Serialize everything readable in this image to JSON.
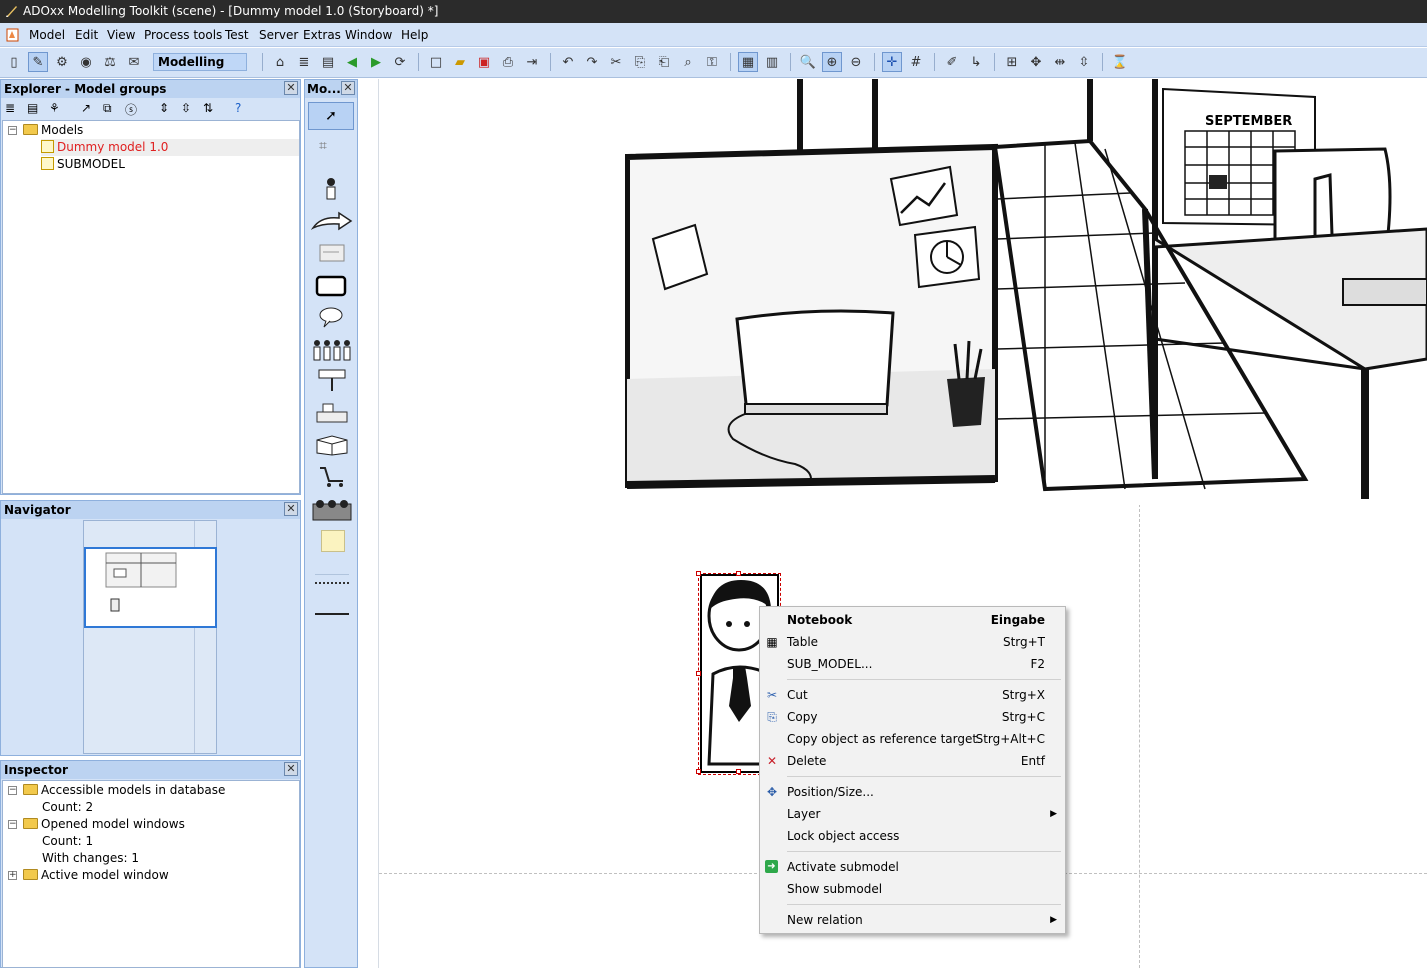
{
  "window": {
    "title": "ADOxx Modelling Toolkit (scene) - [Dummy model 1.0 (Storyboard) *]"
  },
  "menubar": {
    "items": [
      "Model",
      "Edit",
      "View",
      "Process tools",
      "Test",
      "Server",
      "Extras",
      "Window",
      "Help"
    ]
  },
  "toolbar": {
    "mode": "Modelling"
  },
  "explorer": {
    "title": "Explorer - Model groups",
    "root": "Models",
    "items": [
      "Dummy model 1.0",
      "SUBMODEL"
    ]
  },
  "modelling_bar": {
    "title": "Mo..."
  },
  "navigator": {
    "title": "Navigator"
  },
  "inspector": {
    "title": "Inspector",
    "rows": [
      "Accessible models in database",
      "Count: 2",
      "Opened model windows",
      "Count: 1",
      "With changes: 1",
      "Active model window"
    ]
  },
  "canvas": {
    "calendar_label": "SEPTEMBER"
  },
  "context_menu": {
    "items": [
      {
        "label": "Notebook",
        "shortcut": "Eingabe"
      },
      {
        "label": "Table",
        "shortcut": "Strg+T"
      },
      {
        "label": "SUB_MODEL...",
        "shortcut": "F2"
      },
      {
        "label": "Cut",
        "shortcut": "Strg+X"
      },
      {
        "label": "Copy",
        "shortcut": "Strg+C"
      },
      {
        "label": "Copy object as reference target",
        "shortcut": "Strg+Alt+C"
      },
      {
        "label": "Delete",
        "shortcut": "Entf"
      },
      {
        "label": "Position/Size...",
        "shortcut": ""
      },
      {
        "label": "Layer",
        "shortcut": ""
      },
      {
        "label": "Lock object access",
        "shortcut": ""
      },
      {
        "label": "Activate submodel",
        "shortcut": ""
      },
      {
        "label": "Show submodel",
        "shortcut": ""
      },
      {
        "label": "New relation",
        "shortcut": ""
      }
    ]
  },
  "colors": {
    "accent": "#d4e3f7",
    "selected_model": "#e02020"
  }
}
